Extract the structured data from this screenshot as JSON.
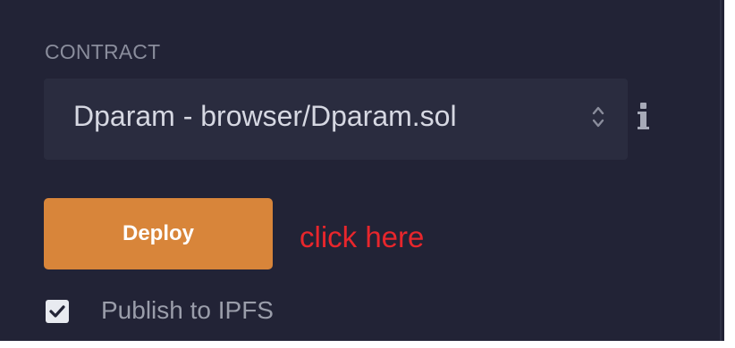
{
  "contract": {
    "label": "CONTRACT",
    "selected_value": "Dparam - browser/Dparam.sol",
    "select_icon": "updown-arrows-icon",
    "info_icon": "info-icon"
  },
  "deploy": {
    "button_label": "Deploy",
    "annotation": "click here",
    "annotation_color": "#e8262c",
    "button_color": "#d8853a"
  },
  "publish": {
    "label": "Publish to IPFS",
    "checked": true
  },
  "colors": {
    "panel_background": "#222336",
    "select_background": "#2a2c3f"
  }
}
